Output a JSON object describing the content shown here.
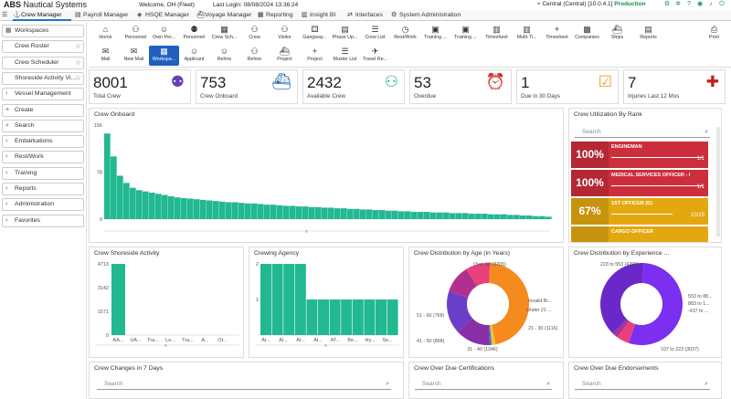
{
  "app": {
    "name_bold": "ABS",
    "name_rest": " Nautical Systems",
    "welcome": "Welcome, OH (Fleet)",
    "last_login": "Last Login: 08/08/2024 13:36:24",
    "environment": "Central (Central) [10.0.4.1]",
    "mode": "Production"
  },
  "modules": [
    {
      "label": "Crew Manager",
      "icon": "crew-icon"
    },
    {
      "label": "Payroll Manager",
      "icon": "payroll-icon"
    },
    {
      "label": "HSQE Manager",
      "icon": "shield-icon"
    },
    {
      "label": "Voyage Manager",
      "icon": "ship-icon"
    },
    {
      "label": "Reporting",
      "icon": "report-icon"
    },
    {
      "label": "Insight BI",
      "icon": "chart-icon"
    },
    {
      "label": "Interfaces",
      "icon": "interfaces-icon"
    },
    {
      "label": "System Administration",
      "icon": "gear-icon"
    }
  ],
  "sidebar": [
    {
      "label": "Workspaces",
      "icon": "workspace-icon",
      "star": false
    },
    {
      "label": "Crew Roster",
      "icon": "",
      "star": true
    },
    {
      "label": "Crew Scheduler",
      "icon": "",
      "star": true
    },
    {
      "label": "Shoreside Activity Vi...",
      "icon": "",
      "star": true
    },
    {
      "label": "Vessel Management",
      "icon": "chevron-right-icon",
      "star": false
    },
    {
      "label": "Create",
      "icon": "plus-icon",
      "star": false
    },
    {
      "label": "Search",
      "icon": "search-icon",
      "star": false
    },
    {
      "label": "Embarkations",
      "icon": "chevron-right-icon",
      "star": false
    },
    {
      "label": "Rest/Work",
      "icon": "chevron-right-icon",
      "star": false
    },
    {
      "label": "Training",
      "icon": "chevron-right-icon",
      "star": false
    },
    {
      "label": "Reports",
      "icon": "chevron-right-icon",
      "star": false
    },
    {
      "label": "Administration",
      "icon": "chevron-right-icon",
      "star": false
    },
    {
      "label": "Favorites",
      "icon": "chevron-right-icon",
      "star": false
    }
  ],
  "toolbar_row1": [
    {
      "label": "Home",
      "icon": "home-icon"
    },
    {
      "label": "Personnel",
      "icon": "person-add-icon"
    },
    {
      "label": "Own Per...",
      "icon": "person-icon"
    },
    {
      "label": "Personnel",
      "icon": "people-icon"
    },
    {
      "label": "Crew Sch...",
      "icon": "calendar-icon"
    },
    {
      "label": "Crew",
      "icon": "person-add-icon"
    },
    {
      "label": "Visitor",
      "icon": "person-add-icon"
    },
    {
      "label": "Gangway...",
      "icon": "gangway-icon"
    },
    {
      "label": "Phase Up...",
      "icon": "document-icon"
    },
    {
      "label": "Crew List",
      "icon": "list-icon"
    },
    {
      "label": "Rest/Work",
      "icon": "clock-icon"
    },
    {
      "label": "Training ...",
      "icon": "training-icon"
    },
    {
      "label": "Training ...",
      "icon": "training-icon"
    },
    {
      "label": "Timesheet",
      "icon": "timesheet-icon"
    },
    {
      "label": "Multi-Ti...",
      "icon": "timesheet-icon"
    },
    {
      "label": "Timesheet",
      "icon": "plus-icon"
    },
    {
      "label": "Companies",
      "icon": "building-icon"
    },
    {
      "label": "Ships",
      "icon": "ship-icon"
    },
    {
      "label": "Reports",
      "icon": "report-icon"
    },
    {
      "label": "Print",
      "icon": "print-icon"
    }
  ],
  "toolbar_row2": [
    {
      "label": "Mail",
      "icon": "mail-icon"
    },
    {
      "label": "New Mail",
      "icon": "mail-icon"
    },
    {
      "label": "Workspa...",
      "icon": "workspace-icon"
    },
    {
      "label": "Applicant",
      "icon": "person-icon"
    },
    {
      "label": "Rehire",
      "icon": "person-icon"
    },
    {
      "label": "Rehire",
      "icon": "person-add-icon"
    },
    {
      "label": "Project",
      "icon": "ship-icon"
    },
    {
      "label": "Project",
      "icon": "plus-icon"
    },
    {
      "label": "Muster List",
      "icon": "list-icon"
    },
    {
      "label": "Travel Re...",
      "icon": "travel-icon"
    }
  ],
  "kpis": [
    {
      "value": "8001",
      "label": "Total Crew",
      "icon": "people-icon",
      "color": "#6a3fb5"
    },
    {
      "value": "753",
      "label": "Crew Onboard",
      "icon": "ship-icon",
      "color": "#1f5fa8"
    },
    {
      "value": "2432",
      "label": "Available Crew",
      "icon": "person-add-icon",
      "color": "#1fae8c"
    },
    {
      "value": "53",
      "label": "Overdue",
      "icon": "alarm-icon",
      "color": "#d03030"
    },
    {
      "value": "1",
      "label": "Due in 30 Days",
      "icon": "calendar-check-icon",
      "color": "#e0a020"
    },
    {
      "value": "7",
      "label": "Injuries Last 12 Mos",
      "icon": "hospital-icon",
      "color": "#c02020"
    }
  ],
  "panels": {
    "crew_onboard": "Crew Onboard",
    "utilization": "Crew Utilization By Rank",
    "shoreside": "Crew Shoreside Activity",
    "agency": "Crewing Agency",
    "age": "Crew Distribution by Age (in Years)",
    "experience": "Crew Distribution by Experience ...",
    "changes": "Crew Changes in 7 Days",
    "certs": "Crew Over Due Certifications",
    "endorse": "Crew Over Due Endorsements"
  },
  "search_placeholder": "Search",
  "ranks": [
    {
      "pct": "100%",
      "name": "ENGINEMAN",
      "count": "1/1",
      "fill": 1.0,
      "color": "#cc2e3c"
    },
    {
      "pct": "100%",
      "name": "MEDICAL SERVICES OFFICER - I",
      "count": "1/1",
      "fill": 1.0,
      "color": "#cc2e3c"
    },
    {
      "pct": "67%",
      "name": "1ST OFFICER (D)",
      "count": "10/15",
      "fill": 0.67,
      "color": "#e3a810"
    },
    {
      "pct": "",
      "name": "CARGO OFFICER",
      "count": "",
      "fill": 0.5,
      "color": "#e3a810"
    }
  ],
  "chart_data": [
    {
      "type": "bar",
      "title": "Crew Onboard",
      "yticks": [
        "156",
        "78",
        "0"
      ],
      "ylim": [
        0,
        156
      ],
      "values": [
        142,
        104,
        72,
        60,
        52,
        48,
        46,
        44,
        42,
        40,
        38,
        36,
        35,
        34,
        33,
        32,
        31,
        30,
        29,
        28,
        28,
        27,
        26,
        26,
        25,
        24,
        24,
        23,
        22,
        22,
        21,
        21,
        20,
        20,
        19,
        19,
        18,
        18,
        17,
        17,
        16,
        16,
        15,
        15,
        14,
        14,
        13,
        13,
        12,
        12,
        12,
        11,
        11,
        11,
        10,
        10,
        10,
        9,
        9,
        9,
        8,
        8,
        8,
        7,
        7,
        6,
        6,
        5,
        5,
        4
      ]
    },
    {
      "type": "bar",
      "title": "Crew Shoreside Activity",
      "yticks": [
        "4713",
        "3142",
        "1571",
        "0"
      ],
      "ylim": [
        0,
        4713
      ],
      "categories": [
        "AA...",
        "UA...",
        "Tra...",
        "Le...",
        "Tra...",
        "A...",
        "Ot..."
      ],
      "values": [
        4713,
        0,
        0,
        0,
        0,
        0,
        0
      ]
    },
    {
      "type": "bar",
      "title": "Crewing Agency",
      "yticks": [
        "2",
        "1"
      ],
      "ylim": [
        0,
        2
      ],
      "categories": [
        "Al...",
        "Al...",
        "Al...",
        "Al...",
        "AT...",
        "Be...",
        "Hy...",
        "Se..."
      ],
      "values": [
        2,
        2,
        2,
        2,
        1,
        1,
        1,
        1,
        1,
        1,
        1,
        1
      ]
    },
    {
      "type": "pie",
      "title": "Crew Distribution by Age (in Years)",
      "slices": [
        {
          "label": "Over 60 (3705)",
          "value": 3705,
          "color": "#f58a1f"
        },
        {
          "label": "Invalid Bi...",
          "value": 120,
          "color": "#f2c230"
        },
        {
          "label": "Under 21 ...",
          "value": 60,
          "color": "#2a7fd4"
        },
        {
          "label": "21 - 30 (1116)",
          "value": 1116,
          "color": "#8a2ea8"
        },
        {
          "label": "31 - 40 (1346)",
          "value": 1346,
          "color": "#6a3fc8"
        },
        {
          "label": "41 - 50 (898)",
          "value": 898,
          "color": "#b03090"
        },
        {
          "label": "51 - 60 (768)",
          "value": 768,
          "color": "#e8407a"
        }
      ]
    },
    {
      "type": "pie",
      "title": "Crew Distribution by Experience ...",
      "slices": [
        {
          "label": "223 to 553 (4296)",
          "value": 4296,
          "color": "#7b2ff0"
        },
        {
          "label": "553 to 88...",
          "value": 400,
          "color": "#e8407a"
        },
        {
          "label": "883 to 1...",
          "value": 120,
          "color": "#b03090"
        },
        {
          "label": "-437 to ...",
          "value": 80,
          "color": "#8a2ea8"
        },
        {
          "label": "107 to 223 (3037)",
          "value": 3037,
          "color": "#6a28c8"
        }
      ]
    }
  ]
}
